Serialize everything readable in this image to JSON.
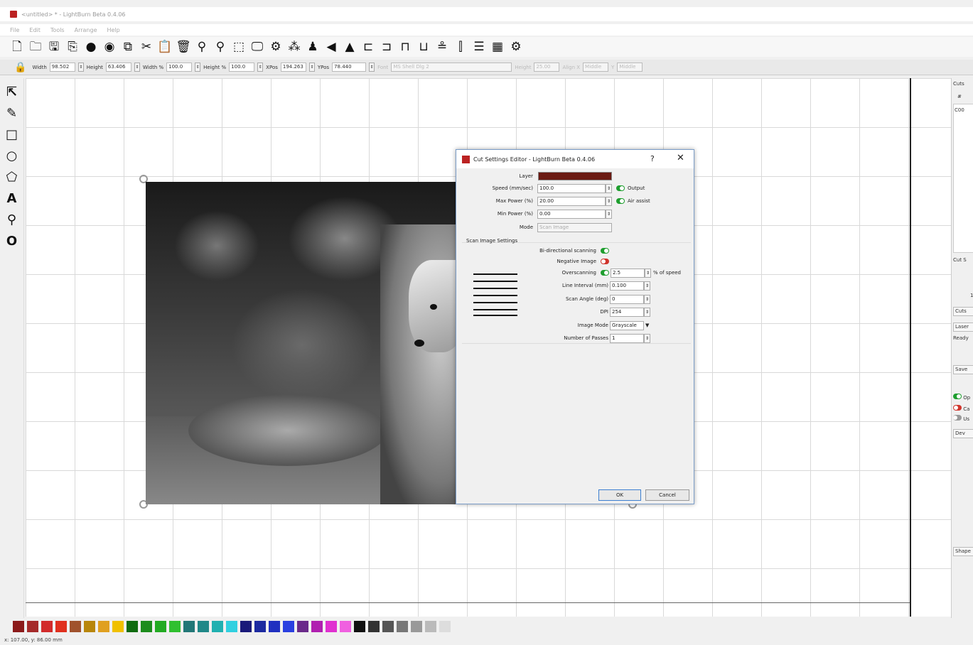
{
  "window": {
    "title": "<untitled> * - LightBurn Beta 0.4.06"
  },
  "menu": [
    "File",
    "Edit",
    "Tools",
    "Arrange",
    "Help"
  ],
  "toolbar_icons": [
    "new-file-icon",
    "open-folder-icon",
    "save-icon",
    "import-icon",
    "zoom-in-icon",
    "zoom-out-icon",
    "copy-icon",
    "cut-icon",
    "paste-icon",
    "delete-icon",
    "zoom-tool-icon",
    "zoom-fit-icon",
    "select-frame-icon",
    "monitor-icon",
    "settings-icon",
    "group-icon",
    "ungroup-icon",
    "flip-horizontal-icon",
    "flip-vertical-icon",
    "align-left-icon",
    "align-right-icon",
    "align-top-icon",
    "align-bottom-icon",
    "align-center-icon",
    "distribute-icon",
    "array-icon",
    "grid-array-icon",
    "gear-icon"
  ],
  "propbar": {
    "width_label": "Width",
    "width": "98.502",
    "height_label": "Height",
    "height": "63.406",
    "width_pct_label": "Width %",
    "width_pct": "100.0",
    "height_pct_label": "Height %",
    "height_pct": "100.0",
    "xpos_label": "XPos",
    "xpos": "194.263",
    "ypos_label": "YPos",
    "ypos": "78.440",
    "font_label": "Font",
    "font": "MS Shell Dlg 2",
    "font_height_label": "Height",
    "font_height": "25.00",
    "align_x_label": "Align X",
    "align_x": "Middle",
    "align_y_label": "Y",
    "align_y": "Middle"
  },
  "left_tools": [
    "select-arrow-icon",
    "pen-icon",
    "rectangle-icon",
    "ellipse-icon",
    "polygon-icon",
    "text-icon",
    "position-marker-icon",
    "offset-icon"
  ],
  "dialog": {
    "title": "Cut Settings Editor - LightBurn Beta 0.4.06",
    "help": "?",
    "close": "✕",
    "layer_label": "Layer",
    "layer_color": "#6b1a12",
    "speed_label": "Speed (mm/sec)",
    "speed": "100.0",
    "output_label": "Output",
    "max_power_label": "Max Power (%)",
    "max_power": "20.00",
    "air_assist_label": "Air assist",
    "min_power_label": "Min Power (%)",
    "min_power": "0.00",
    "mode_label": "Mode",
    "mode": "Scan Image",
    "scan_section_label": "Scan Image Settings",
    "bidir_label": "Bi-directional scanning",
    "negative_label": "Negative Image",
    "overscan_label": "Overscanning",
    "overscan": "2.5",
    "overscan_unit": "% of speed",
    "line_interval_label": "Line Interval (mm)",
    "line_interval": "0.100",
    "scan_angle_label": "Scan Angle (deg)",
    "scan_angle": "0",
    "dpi_label": "DPI",
    "dpi": "254",
    "image_mode_label": "Image Mode",
    "image_mode": "Grayscale",
    "passes_label": "Number of Passes",
    "passes": "1",
    "ok": "OK",
    "cancel": "Cancel"
  },
  "right_panel": {
    "cuts_tab": "Cuts",
    "col_hash": "#",
    "row1": "C00",
    "cut_settings_label": "Cut S",
    "one": "1",
    "cuts_btn": "Cuts",
    "laser_btn": "Laser",
    "ready": "Ready",
    "save_btn": "Save",
    "opt1": "Op",
    "opt2": "Ca",
    "opt3": "Us",
    "dev_btn": "Dev",
    "shape_btn": "Shape"
  },
  "palette": [
    "#8b1a1a",
    "#a52a2a",
    "#d22b2b",
    "#e0301e",
    "#a0522d",
    "#b8860b",
    "#e0a020",
    "#f0c000",
    "#106b10",
    "#1c8c1c",
    "#22aa22",
    "#30c030",
    "#227777",
    "#208888",
    "#20b0b0",
    "#30d0e0",
    "#1a1a7a",
    "#1c2aa0",
    "#2030c0",
    "#2a40e0",
    "#6a2a8a",
    "#b020b0",
    "#e030d0",
    "#f060e0",
    "#111111",
    "#333333",
    "#555555",
    "#777777",
    "#999999",
    "#bbbbbb",
    "#dddddd"
  ],
  "status": "x: 107.00, y: 86.00 mm"
}
